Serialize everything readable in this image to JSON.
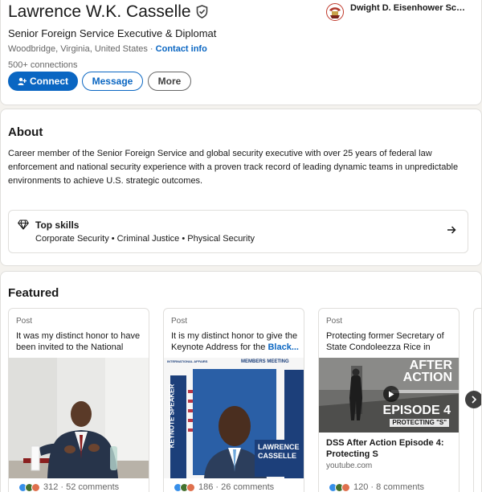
{
  "profile": {
    "name": "Lawrence W.K. Casselle",
    "headline": "Senior Foreign Service Executive & Diplomat",
    "location": "Woodbridge, Virginia, United States",
    "separator": " · ",
    "contact_info": "Contact info",
    "connections": "500+ connections",
    "buttons": {
      "connect": "Connect",
      "message": "Message",
      "more": "More"
    },
    "school": "Dwight D. Eisenhower School for National Securi..."
  },
  "about": {
    "title": "About",
    "text": "Career member of the Senior Foreign Service and global security executive with over 25 years of federal law enforcement and national security experience with a proven track record of leading dynamic teams in unpredictable environments to achieve U.S. strategic outcomes.",
    "top_skills": {
      "title": "Top skills",
      "list": "Corporate Security • Criminal Justice • Physical Security"
    }
  },
  "featured": {
    "title": "Featured",
    "items": [
      {
        "type": "Post",
        "snippet": "It was my distinct honor to have been invited to the National Wa...",
        "reactions": "312 · 52 comments"
      },
      {
        "type": "Post",
        "snippet": "It is my distinct honor to give the Keynote Address for the ",
        "snippet_link": "Black...",
        "media_text": {
          "header": "INTERNATIONAL AFFAIRS",
          "meeting": "MEMBERS MEETING",
          "keynote": "KEYNOTE SPEAKER",
          "first": "LAWRENCE",
          "last": "CASSELLE"
        },
        "reactions": "186 · 26 comments"
      },
      {
        "type": "Post",
        "snippet": "Protecting former Secretary of State Condoleezza Rice in som...",
        "media_text": {
          "title1": "AFTER",
          "title2": "ACTION",
          "episode": "EPISODE 4",
          "subtitle": "PROTECTING \"S\""
        },
        "link_title": "DSS After Action Episode 4: Protecting S",
        "link_source": "youtube.com",
        "reactions": "120 · 8 comments"
      }
    ]
  },
  "colors": {
    "accent": "#0a66c2",
    "like": "#378fe9",
    "celebrate": "#44712e",
    "love": "#df704d"
  }
}
